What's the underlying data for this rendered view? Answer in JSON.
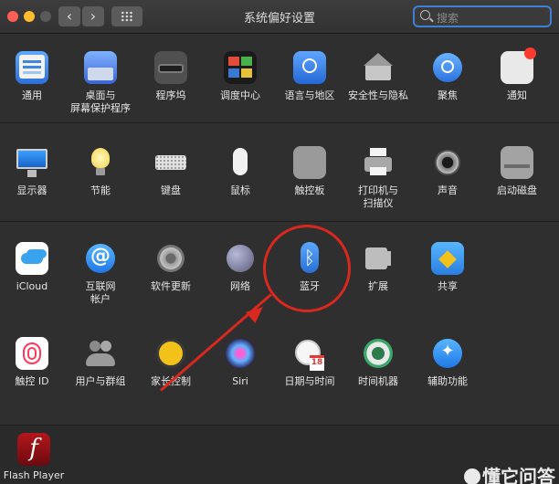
{
  "window": {
    "title": "系统偏好设置"
  },
  "search": {
    "placeholder": "搜索"
  },
  "rows": [
    {
      "items": [
        {
          "label": "通用",
          "icon": "general-icon"
        },
        {
          "label": "桌面与\n屏幕保护程序",
          "icon": "desktop-screensaver-icon"
        },
        {
          "label": "程序坞",
          "icon": "dock-icon"
        },
        {
          "label": "调度中心",
          "icon": "mission-control-icon"
        },
        {
          "label": "语言与地区",
          "icon": "language-region-icon"
        },
        {
          "label": "安全性与隐私",
          "icon": "security-privacy-icon"
        },
        {
          "label": "聚焦",
          "icon": "spotlight-icon"
        },
        {
          "label": "通知",
          "icon": "notifications-icon"
        }
      ]
    },
    {
      "items": [
        {
          "label": "显示器",
          "icon": "displays-icon"
        },
        {
          "label": "节能",
          "icon": "energy-saver-icon"
        },
        {
          "label": "键盘",
          "icon": "keyboard-icon"
        },
        {
          "label": "鼠标",
          "icon": "mouse-icon"
        },
        {
          "label": "触控板",
          "icon": "trackpad-icon"
        },
        {
          "label": "打印机与\n扫描仪",
          "icon": "printers-scanners-icon"
        },
        {
          "label": "声音",
          "icon": "sound-icon"
        },
        {
          "label": "启动磁盘",
          "icon": "startup-disk-icon"
        }
      ]
    },
    {
      "items": [
        {
          "label": "iCloud",
          "icon": "icloud-icon"
        },
        {
          "label": "互联网\n帐户",
          "icon": "internet-accounts-icon"
        },
        {
          "label": "软件更新",
          "icon": "software-update-icon"
        },
        {
          "label": "网络",
          "icon": "network-icon"
        },
        {
          "label": "蓝牙",
          "icon": "bluetooth-icon"
        },
        {
          "label": "扩展",
          "icon": "extensions-icon"
        },
        {
          "label": "共享",
          "icon": "sharing-icon"
        }
      ]
    },
    {
      "items": [
        {
          "label": "触控 ID",
          "icon": "touch-id-icon"
        },
        {
          "label": "用户与群组",
          "icon": "users-groups-icon"
        },
        {
          "label": "家长控制",
          "icon": "parental-controls-icon"
        },
        {
          "label": "Siri",
          "icon": "siri-icon"
        },
        {
          "label": "日期与时间",
          "icon": "date-time-icon"
        },
        {
          "label": "时间机器",
          "icon": "time-machine-icon"
        },
        {
          "label": "辅助功能",
          "icon": "accessibility-icon"
        }
      ]
    },
    {
      "items": [
        {
          "label": "Flash Player",
          "icon": "flash-player-icon"
        }
      ]
    }
  ],
  "watermark": {
    "text": "懂它问答"
  }
}
